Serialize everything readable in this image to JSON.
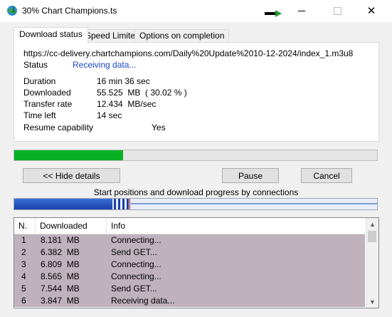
{
  "window": {
    "title": "30% Chart Champions.ts",
    "app_icon": "idm-globe-icon",
    "close_glyph": "✕"
  },
  "tabs": [
    {
      "label": "Download status",
      "active": true
    },
    {
      "label": "Speed Limiter",
      "active": false
    },
    {
      "label": "Options on completion",
      "active": false
    }
  ],
  "status": {
    "url": "https://cc-delivery.chartchampions.com/Daily%20Update%2010-12-2024/index_1.m3u8",
    "status_label": "Status",
    "status_value": "Receiving data...",
    "duration_label": "Duration",
    "duration_value": "16 min 36 sec",
    "downloaded_label": "Downloaded",
    "downloaded_value": "55.525  MB  ( 30.02 % )",
    "rate_label": "Transfer rate",
    "rate_value": "12.434  MB/sec",
    "time_left_label": "Time left",
    "time_left_value": "14 sec",
    "resume_label": "Resume capability",
    "resume_value": "Yes"
  },
  "progress": {
    "percent": 30.02,
    "color": "#06b025"
  },
  "buttons": {
    "hide_details": "<< Hide details",
    "pause": "Pause",
    "cancel": "Cancel"
  },
  "connections_caption": "Start positions and download progress by connections",
  "connections": {
    "columns": [
      "N.",
      "Downloaded",
      "Info"
    ],
    "rows": [
      {
        "n": "1",
        "downloaded": "8.181  MB",
        "info": "Connecting..."
      },
      {
        "n": "2",
        "downloaded": "6.382  MB",
        "info": "Send GET..."
      },
      {
        "n": "3",
        "downloaded": "6.809  MB",
        "info": "Connecting..."
      },
      {
        "n": "4",
        "downloaded": "8.565  MB",
        "info": "Connecting..."
      },
      {
        "n": "5",
        "downloaded": "7.544  MB",
        "info": "Send GET..."
      },
      {
        "n": "6",
        "downloaded": "3.847  MB",
        "info": "Receiving data..."
      }
    ],
    "row_color": "#bfb2bd"
  }
}
